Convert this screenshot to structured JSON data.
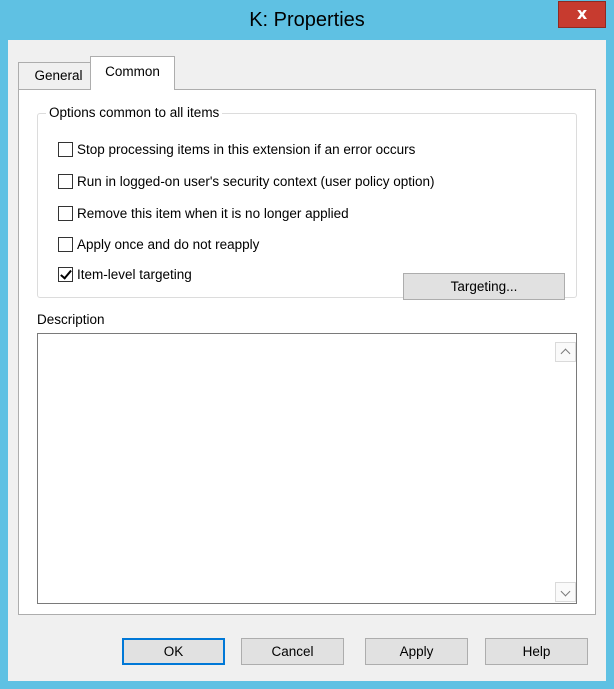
{
  "window": {
    "title": "K: Properties",
    "close_label": "x"
  },
  "tabs": [
    {
      "label": "General",
      "active": false
    },
    {
      "label": "Common",
      "active": true
    }
  ],
  "options_group": {
    "title": "Options common to all items",
    "checkboxes": [
      {
        "label": "Stop processing items in this extension if an error occurs",
        "checked": false
      },
      {
        "label": "Run in logged-on user's security context (user policy option)",
        "checked": false
      },
      {
        "label": "Remove this item when it is no longer applied",
        "checked": false
      },
      {
        "label": "Apply once and do not reapply",
        "checked": false
      },
      {
        "label": "Item-level targeting",
        "checked": true
      }
    ],
    "targeting_button": "Targeting..."
  },
  "description": {
    "label": "Description",
    "value": ""
  },
  "buttons": {
    "ok": "OK",
    "cancel": "Cancel",
    "apply": "Apply",
    "help": "Help"
  },
  "colors": {
    "title_bar": "#5fc1e3",
    "close_button": "#c73b2f",
    "default_button_border": "#0078d7"
  }
}
